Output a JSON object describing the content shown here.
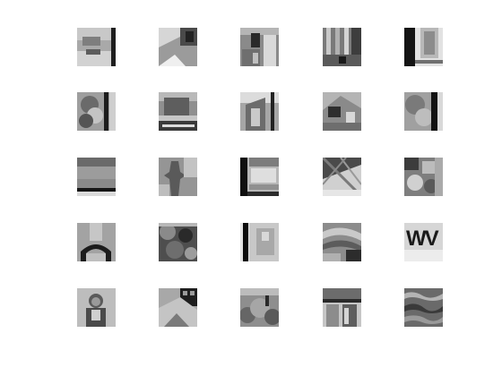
{
  "figure": {
    "rows": 5,
    "columns": 5,
    "tile_count": 25,
    "tile_style": "grayscale image patch",
    "background_color": "#ffffff"
  },
  "tiles": [
    {
      "row": 1,
      "col": 1,
      "content": "street-scene-patch"
    },
    {
      "row": 1,
      "col": 2,
      "content": "building-corner-patch"
    },
    {
      "row": 1,
      "col": 3,
      "content": "facade-window-patch"
    },
    {
      "row": 1,
      "col": 4,
      "content": "building-columns-patch"
    },
    {
      "row": 1,
      "col": 5,
      "content": "dark-pillar-patch"
    },
    {
      "row": 2,
      "col": 1,
      "content": "foliage-figure-patch"
    },
    {
      "row": 2,
      "col": 2,
      "content": "roof-structure-patch"
    },
    {
      "row": 2,
      "col": 3,
      "content": "doorway-patch"
    },
    {
      "row": 2,
      "col": 4,
      "content": "house-gable-patch"
    },
    {
      "row": 2,
      "col": 5,
      "content": "tree-wall-patch"
    },
    {
      "row": 3,
      "col": 1,
      "content": "horizon-band-patch"
    },
    {
      "row": 3,
      "col": 2,
      "content": "statue-patch"
    },
    {
      "row": 3,
      "col": 3,
      "content": "window-frame-patch"
    },
    {
      "row": 3,
      "col": 4,
      "content": "rafters-patch"
    },
    {
      "row": 3,
      "col": 5,
      "content": "rubble-patch"
    },
    {
      "row": 4,
      "col": 1,
      "content": "arch-patch"
    },
    {
      "row": 4,
      "col": 2,
      "content": "dark-foliage-patch"
    },
    {
      "row": 4,
      "col": 3,
      "content": "pole-patch"
    },
    {
      "row": 4,
      "col": 4,
      "content": "water-patch"
    },
    {
      "row": 4,
      "col": 5,
      "content": "sign-text-patch",
      "text": "WV"
    },
    {
      "row": 5,
      "col": 1,
      "content": "portrait-patch"
    },
    {
      "row": 5,
      "col": 2,
      "content": "roof-window-patch"
    },
    {
      "row": 5,
      "col": 3,
      "content": "shrubs-patch"
    },
    {
      "row": 5,
      "col": 4,
      "content": "storefront-patch"
    },
    {
      "row": 5,
      "col": 5,
      "content": "texture-patch"
    }
  ]
}
